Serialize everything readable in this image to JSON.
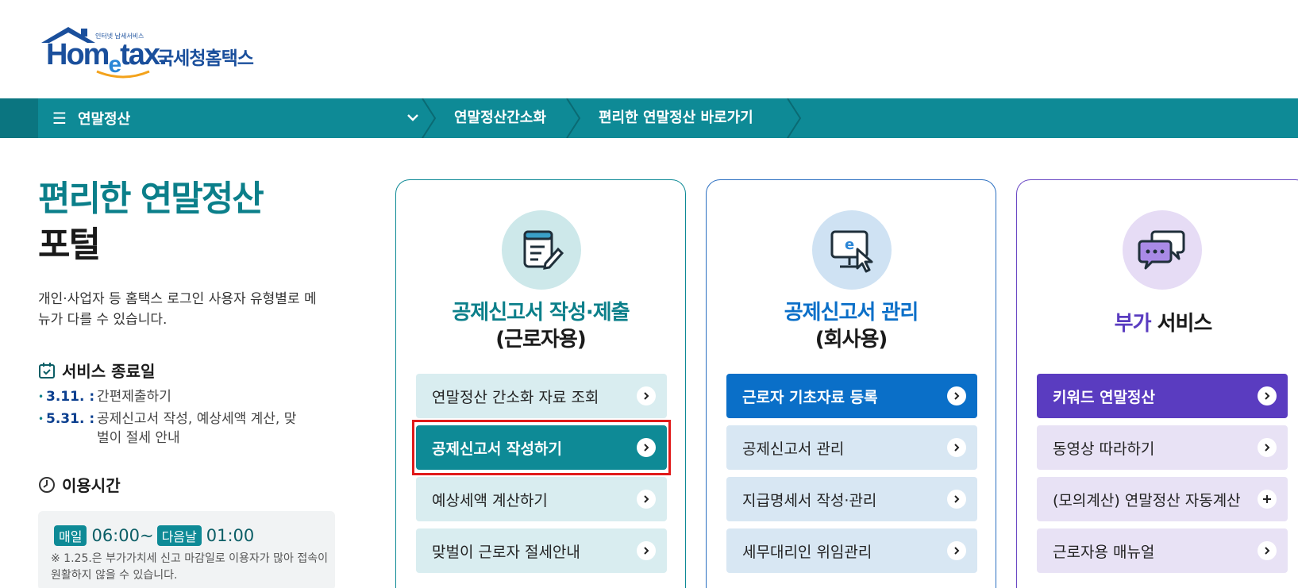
{
  "header": {
    "logo_small": "인터넷 납세서비스",
    "logo_word_a": "Hom",
    "logo_word_e": "e",
    "logo_word_b": "tax.",
    "logo_korean": "국세청홈택스"
  },
  "nav": {
    "menu_label": "연말정산",
    "links": [
      "연말정산간소화",
      "편리한 연말정산 바로가기"
    ],
    "color": "#0e8a96"
  },
  "intro": {
    "title_line1": "편리한 연말정산",
    "title_line2": "포털",
    "description": "개인·사업자 등 홈택스 로그인 사용자 유형별로 메뉴가 다를 수 있습니다."
  },
  "service_end": {
    "title": "서비스 종료일",
    "items": [
      {
        "date": "3.11. :",
        "text": "간편제출하기"
      },
      {
        "date": "5.31. :",
        "text": "공제신고서 작성, 예상세액 계산, 맞벌이 절세 안내"
      }
    ]
  },
  "hours": {
    "title": "이용시간",
    "badge_daily": "매일",
    "start": "06:00~",
    "badge_next": "다음날",
    "end": "01:00",
    "note": "※ 1.25.은 부가가치세 신고 마감일로 이용자가 많아 접속이 원활하지 않을 수 있습니다."
  },
  "cards": [
    {
      "title_line1": "공제신고서 작성·제출",
      "title_line2": "(근로자용)",
      "accent": "#0e8a96",
      "icon": "document-pen-icon",
      "buttons": [
        {
          "label": "연말정산 간소화 자료 조회",
          "style": "light",
          "arrow": "chevron-right"
        },
        {
          "label": "공제신고서 작성하기",
          "style": "primary",
          "arrow": "chevron-right"
        },
        {
          "label": "예상세액 계산하기",
          "style": "light",
          "arrow": "chevron-right"
        },
        {
          "label": "맞벌이 근로자 절세안내",
          "style": "light",
          "arrow": "chevron-right"
        }
      ]
    },
    {
      "title_line1": "공제신고서 관리",
      "title_line2": "(회사용)",
      "accent": "#0a6fc8",
      "icon": "monitor-cursor-icon",
      "buttons": [
        {
          "label": "근로자 기초자료 등록",
          "style": "primary",
          "arrow": "chevron-right"
        },
        {
          "label": "공제신고서 관리",
          "style": "light",
          "arrow": "chevron-right"
        },
        {
          "label": "지급명세서 작성·관리",
          "style": "light",
          "arrow": "chevron-right"
        },
        {
          "label": "세무대리인 위임관리",
          "style": "light",
          "arrow": "chevron-right"
        }
      ]
    },
    {
      "title_a": "부가",
      "title_b": " 서비스",
      "accent": "#5a3cc0",
      "icon": "chat-bubbles-icon",
      "buttons": [
        {
          "label": "키워드 연말정산",
          "style": "primary",
          "arrow": "chevron-right"
        },
        {
          "label": "동영상 따라하기",
          "style": "light",
          "arrow": "chevron-right"
        },
        {
          "label": "(모의계산) 연말정산 자동계산",
          "style": "light",
          "arrow": "plus"
        },
        {
          "label": "근로자용 매뉴얼",
          "style": "light",
          "arrow": "chevron-right"
        }
      ]
    }
  ]
}
